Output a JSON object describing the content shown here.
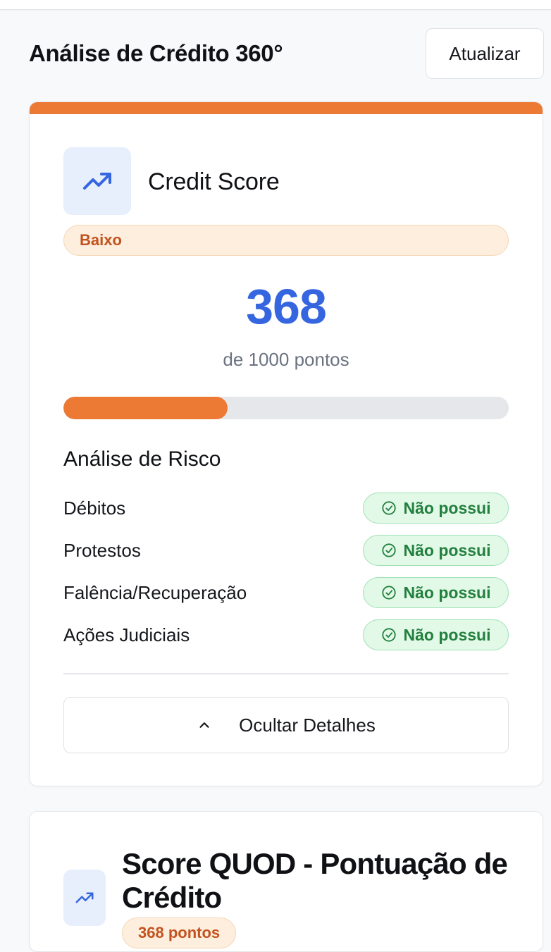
{
  "header": {
    "title": "Análise de Crédito 360°",
    "refresh_label": "Atualizar"
  },
  "credit_card": {
    "title": "Credit Score",
    "icon": "trending-up-icon",
    "risk_level": "Baixo",
    "score": "368",
    "score_scale": "de 1000 pontos",
    "progress_fraction": 0.368,
    "section_title": "Análise de Risco",
    "risks": [
      {
        "label": "Débitos",
        "status": "Não possui"
      },
      {
        "label": "Protestos",
        "status": "Não possui"
      },
      {
        "label": "Falência/Recuperação",
        "status": "Não possui"
      },
      {
        "label": "Ações Judiciais",
        "status": "Não possui"
      }
    ],
    "toggle_label": "Ocultar Detalhes"
  },
  "quod_card": {
    "title": "Score QUOD - Pontuação de Crédito",
    "icon": "trending-up-icon",
    "points": "368 pontos"
  },
  "colors": {
    "accent": "#ec7a35",
    "score_blue": "#3566e0",
    "success_green": "#24803f",
    "warning_orange": "#c2531f"
  }
}
